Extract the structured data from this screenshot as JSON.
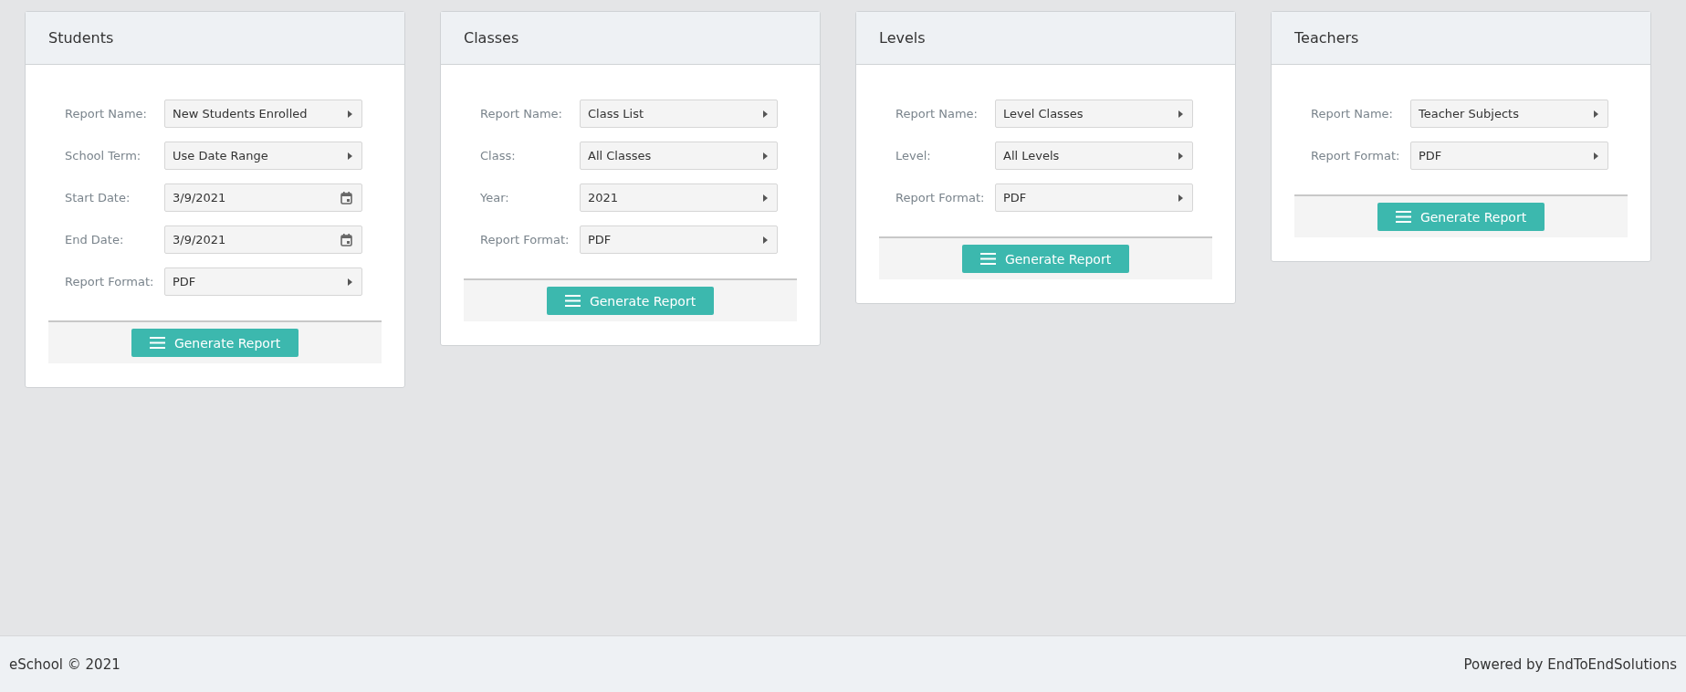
{
  "cards": [
    {
      "title": "Students",
      "fields": [
        {
          "label": "Report Name:",
          "value": "New Students Enrolled",
          "kind": "select"
        },
        {
          "label": "School Term:",
          "value": "Use Date Range",
          "kind": "select"
        },
        {
          "label": "Start Date:",
          "value": "3/9/2021",
          "kind": "date"
        },
        {
          "label": "End Date:",
          "value": "3/9/2021",
          "kind": "date"
        },
        {
          "label": "Report Format:",
          "value": "PDF",
          "kind": "select"
        }
      ],
      "button": "Generate Report"
    },
    {
      "title": "Classes",
      "fields": [
        {
          "label": "Report Name:",
          "value": "Class List",
          "kind": "select"
        },
        {
          "label": "Class:",
          "value": "All Classes",
          "kind": "select"
        },
        {
          "label": "Year:",
          "value": "2021",
          "kind": "select"
        },
        {
          "label": "Report Format:",
          "value": "PDF",
          "kind": "select"
        }
      ],
      "button": "Generate Report"
    },
    {
      "title": "Levels",
      "fields": [
        {
          "label": "Report Name:",
          "value": "Level Classes",
          "kind": "select"
        },
        {
          "label": "Level:",
          "value": "All Levels",
          "kind": "select"
        },
        {
          "label": "Report Format:",
          "value": "PDF",
          "kind": "select"
        }
      ],
      "button": "Generate Report"
    },
    {
      "title": "Teachers",
      "fields": [
        {
          "label": "Report Name:",
          "value": "Teacher Subjects",
          "kind": "select"
        },
        {
          "label": "Report Format:",
          "value": "PDF",
          "kind": "select"
        }
      ],
      "button": "Generate Report"
    }
  ],
  "footer": {
    "left": "eSchool © 2021",
    "right": "Powered by EndToEndSolutions"
  }
}
